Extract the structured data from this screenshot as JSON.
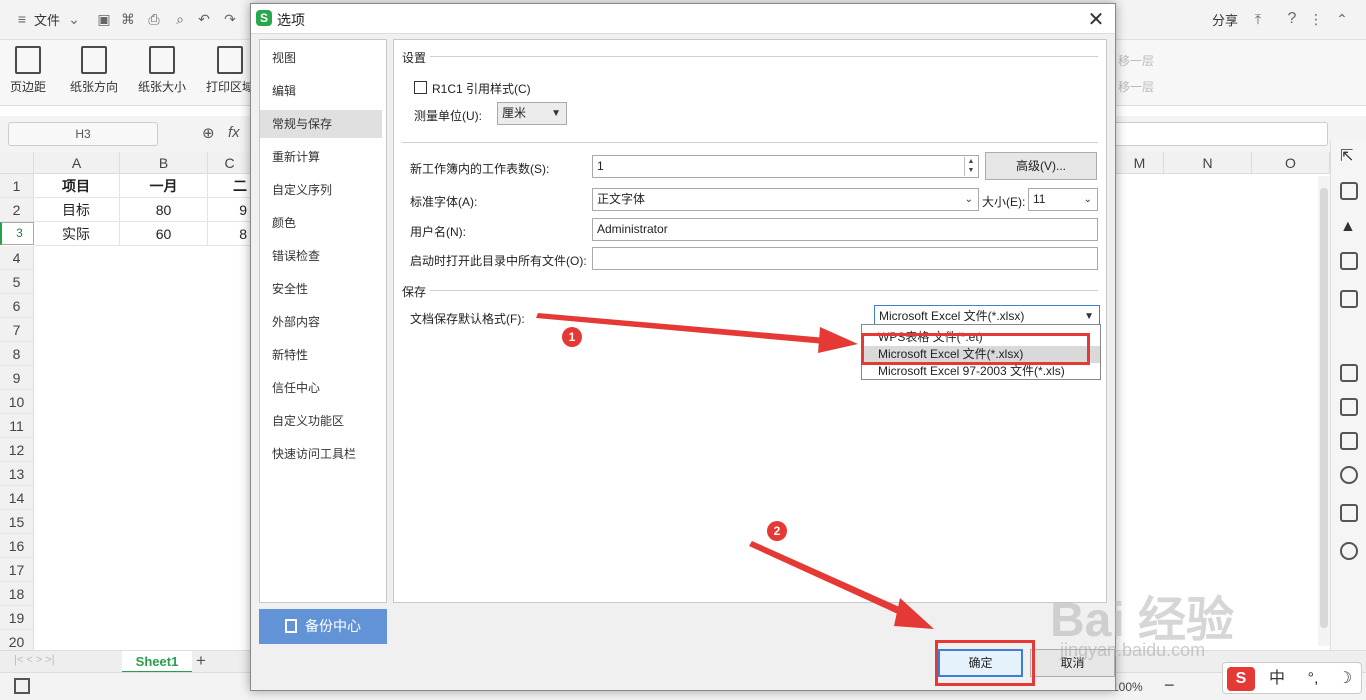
{
  "app": {
    "file_menu": "文件",
    "share": "分享",
    "help": "?",
    "ribbon_buttons": [
      "页边距",
      "纸张方向",
      "纸张大小",
      "打印区域"
    ],
    "ribbon_right": [
      "移一层",
      "移一层"
    ],
    "namebox": "H3",
    "fx": "fx",
    "columns": [
      "A",
      "B",
      "C",
      "M",
      "N",
      "O"
    ],
    "rows": [
      "1",
      "2",
      "3",
      "4",
      "5",
      "6",
      "7",
      "8",
      "9",
      "10",
      "11",
      "12",
      "13",
      "14",
      "15",
      "16",
      "17",
      "18",
      "19",
      "20"
    ],
    "cells": {
      "a1": "项目",
      "b1": "一月",
      "c1": "二",
      "a2": "目标",
      "b2": "80",
      "c2": "9",
      "a3": "实际",
      "b3": "60",
      "c3": "8"
    },
    "sheet_tab": "Sheet1",
    "add_sheet": "+",
    "zoom": "100%"
  },
  "dialog": {
    "title": "选项",
    "logo": "S",
    "close": "✕",
    "nav": [
      "视图",
      "编辑",
      "常规与保存",
      "重新计算",
      "自定义序列",
      "颜色",
      "错误检查",
      "安全性",
      "外部内容",
      "新特性",
      "信任中心",
      "自定义功能区",
      "快速访问工具栏"
    ],
    "active_nav": "常规与保存",
    "backup_center": "备份中心",
    "settings": {
      "section": "设置",
      "r1c1": "R1C1 引用样式(C)",
      "unit_label": "测量单位(U):",
      "unit_value": "厘米",
      "sheets_label": "新工作簿内的工作表数(S):",
      "sheets_value": "1",
      "advanced_button": "高级(V)...",
      "font_label": "标准字体(A):",
      "font_value": "正文字体",
      "size_label": "大小(E):",
      "size_value": "11",
      "user_label": "用户名(N):",
      "user_value": "Administrator",
      "startup_label": "启动时打开此目录中所有文件(O):",
      "startup_value": ""
    },
    "save": {
      "section": "保存",
      "format_label": "文档保存默认格式(F):",
      "format_value": "Microsoft Excel 文件(*.xlsx)",
      "options": [
        "WPS表格 文件(*.et)",
        "Microsoft Excel 文件(*.xlsx)",
        "Microsoft Excel 97-2003 文件(*.xls)"
      ],
      "highlighted_option": "Microsoft Excel 文件(*.xlsx)"
    },
    "ok": "确定",
    "cancel": "取消"
  },
  "annotations": {
    "badge1": "1",
    "badge2": "2",
    "color": "#e53935"
  },
  "watermark": {
    "main": "Bai 经验",
    "url": "jingyan.baidu.com"
  },
  "ime": {
    "items": [
      "S",
      "中",
      "☽"
    ]
  }
}
